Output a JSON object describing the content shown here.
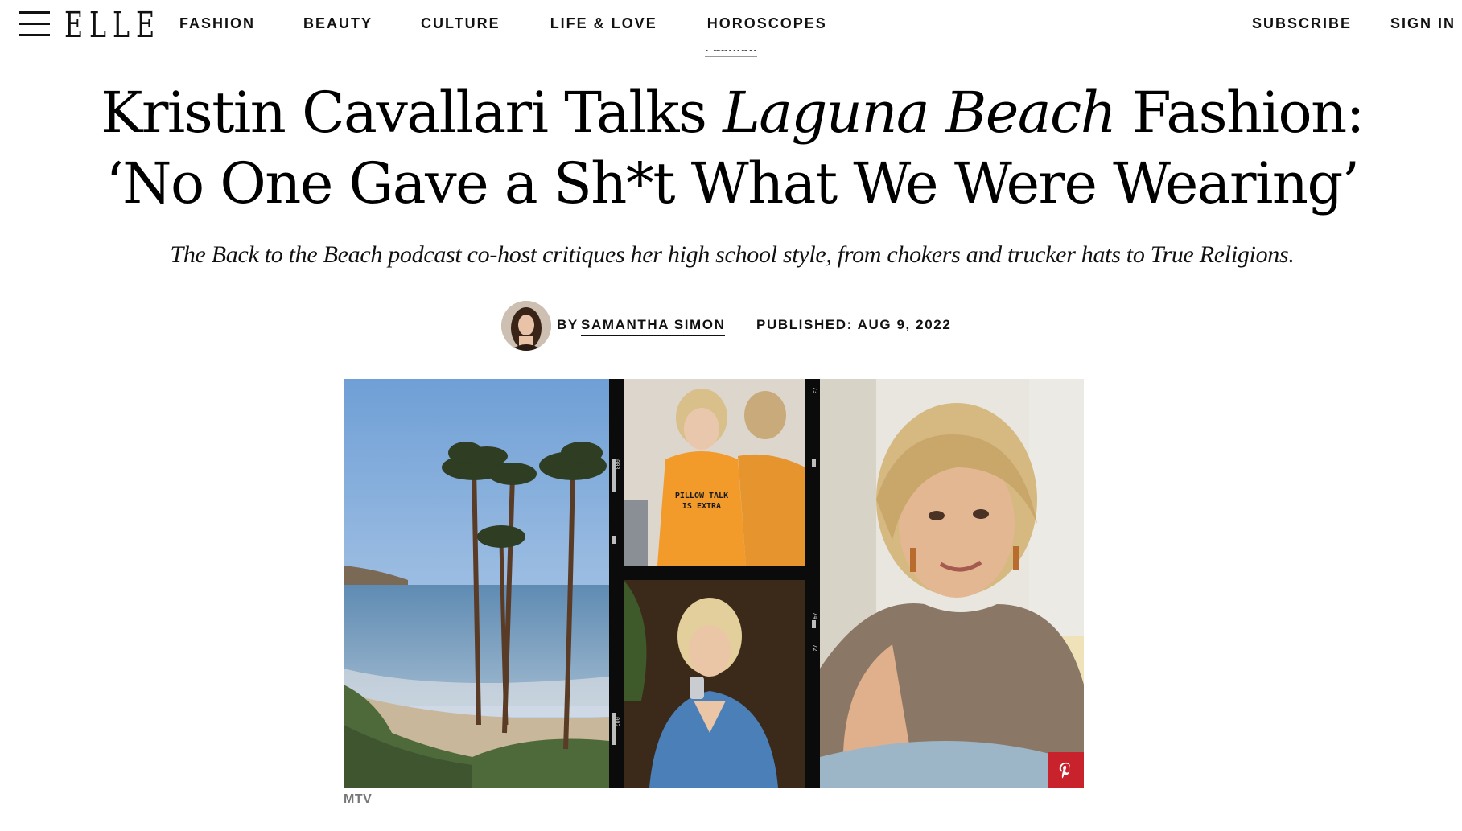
{
  "header": {
    "logo": "ELLE",
    "nav": [
      "FASHION",
      "BEAUTY",
      "CULTURE",
      "LIFE & LOVE",
      "HOROSCOPES"
    ],
    "subscribe": "SUBSCRIBE",
    "sign_in": "SIGN IN"
  },
  "article": {
    "category": "Fashion",
    "title_part1": "Kristin Cavallari Talks ",
    "title_italic": "Laguna Beach",
    "title_part2": " Fashion: ‘No One Gave a Sh*t What We Were Wearing’",
    "dek": "The Back to the Beach podcast co-host critiques her high school style, from chokers and trucker hats to True Religions.",
    "by_label": "BY",
    "author": "SAMANTHA SIMON",
    "published": "PUBLISHED: AUG 9, 2022"
  },
  "hero": {
    "shirt_text_line1": "PILLOW TALK",
    "shirt_text_line2": "IS EXTRA",
    "film_frame_top": "003",
    "film_frame_bottom": "002",
    "film_frame_right_top": "73",
    "film_frame_right_a": "74",
    "film_frame_right_b": "72",
    "credit": "MTV"
  },
  "colors": {
    "pinterest": "#c8232c",
    "text": "#111111"
  }
}
